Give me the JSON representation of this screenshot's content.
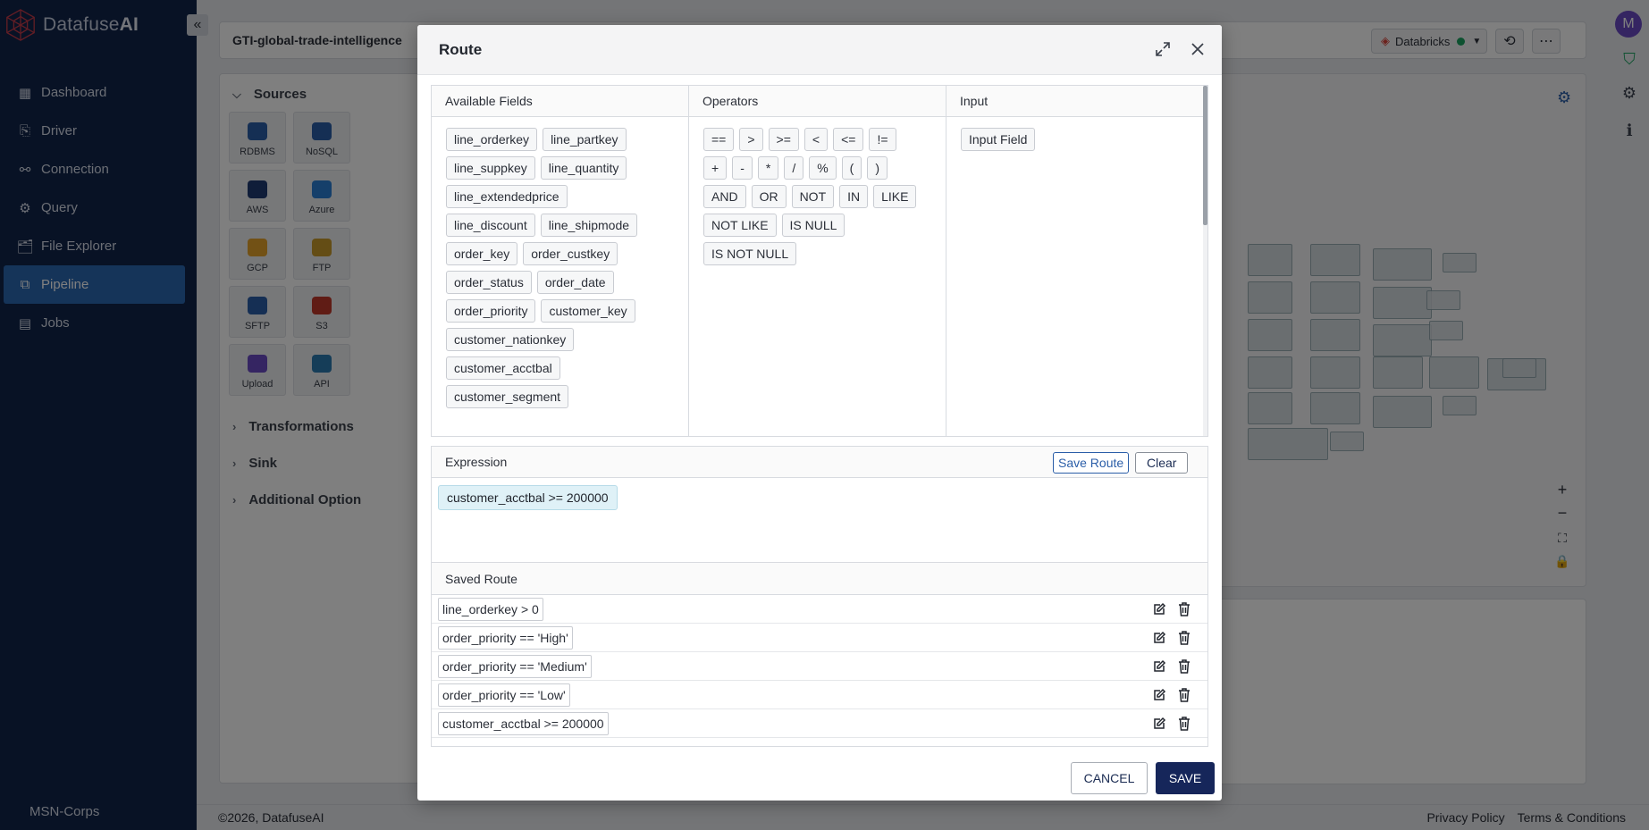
{
  "app": {
    "brand_prefix": "Datafuse",
    "brand_suffix": "AI",
    "collapse_icon": "double-chevron-left",
    "pipeline_title": "GTI-global-trade-intelligence",
    "engine_label": "Databricks",
    "engine_status_color": "#1aa260",
    "avatar_initial": "M",
    "org_name": "MSN-Corps"
  },
  "sidebar": {
    "items": [
      {
        "label": "Dashboard",
        "icon": "grid-icon",
        "active": false
      },
      {
        "label": "Driver",
        "icon": "driver-icon",
        "active": false
      },
      {
        "label": "Connection",
        "icon": "connection-icon",
        "active": false
      },
      {
        "label": "Query",
        "icon": "query-icon",
        "active": false
      },
      {
        "label": "File Explorer",
        "icon": "file-explorer-icon",
        "active": false
      },
      {
        "label": "Pipeline",
        "icon": "pipeline-icon",
        "active": true
      },
      {
        "label": "Jobs",
        "icon": "jobs-icon",
        "active": false
      }
    ]
  },
  "panel": {
    "sources_label": "Sources",
    "sources": [
      "RDBMS",
      "NoSQL",
      "AWS",
      "Azure",
      "GCP",
      "FTP",
      "SFTP",
      "S3",
      "Upload",
      "API"
    ],
    "transformations_label": "Transformations",
    "sink_label": "Sink",
    "additional_label": "Additional Option"
  },
  "footer": {
    "copyright": "©2026, DatafuseAI",
    "privacy": "Privacy Policy",
    "terms": "Terms & Conditions"
  },
  "modal": {
    "title": "Route",
    "available_fields_label": "Available Fields",
    "operators_label": "Operators",
    "input_label": "Input",
    "fields": [
      "line_orderkey",
      "line_partkey",
      "line_suppkey",
      "line_quantity",
      "line_extendedprice",
      "line_discount",
      "line_shipmode",
      "order_key",
      "order_custkey",
      "order_status",
      "order_date",
      "order_priority",
      "customer_key",
      "customer_nationkey",
      "customer_acctbal",
      "customer_segment"
    ],
    "operators": [
      "==",
      ">",
      ">=",
      "<",
      "<=",
      "!=",
      "+",
      "-",
      "*",
      "/",
      "%",
      "(",
      ")",
      "AND",
      "OR",
      "NOT",
      "IN",
      "LIKE",
      "NOT LIKE",
      "IS NULL",
      "IS NOT NULL"
    ],
    "input_field_label": "Input Field",
    "expression_label": "Expression",
    "save_route_label": "Save Route",
    "clear_label": "Clear",
    "current_expression": "customer_acctbal >= 200000",
    "saved_route_label": "Saved Route",
    "saved_routes": [
      "line_orderkey > 0",
      "order_priority == 'High'",
      "order_priority == 'Medium'",
      "order_priority == 'Low'",
      "customer_acctbal >= 200000"
    ],
    "cancel_label": "CANCEL",
    "save_label": "SAVE"
  }
}
